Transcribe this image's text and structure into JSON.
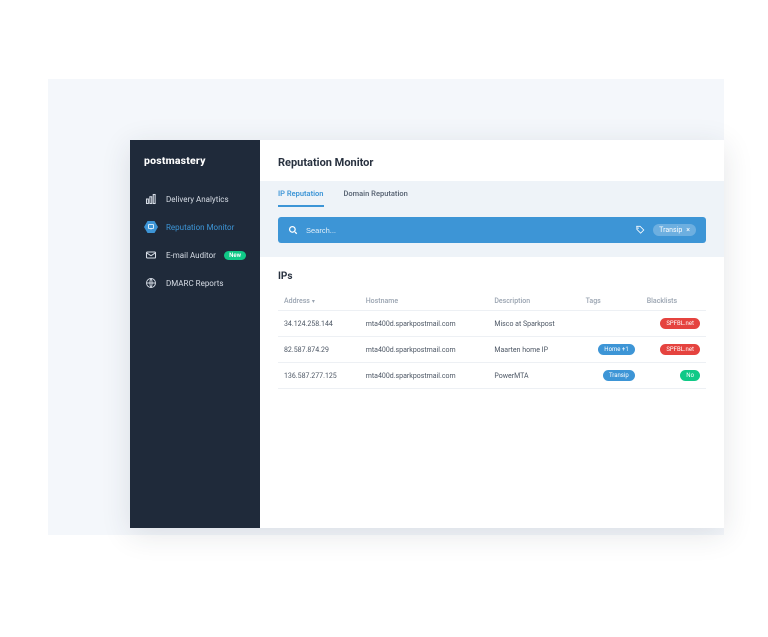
{
  "brand": "postmastery",
  "sidebar": {
    "items": [
      {
        "label": "Delivery Analytics"
      },
      {
        "label": "Reputation Monitor"
      },
      {
        "label": "E-mail Auditor",
        "badge": "New"
      },
      {
        "label": "DMARC Reports"
      }
    ]
  },
  "page": {
    "title": "Reputation Monitor",
    "tabs": [
      {
        "label": "IP Reputation",
        "active": true
      },
      {
        "label": "Domain Reputation",
        "active": false
      }
    ],
    "search": {
      "placeholder": "Search...",
      "active_filter": {
        "label": "Transip"
      }
    },
    "ips": {
      "heading": "IPs",
      "columns": {
        "address": "Address",
        "hostname": "Hostname",
        "description": "Description",
        "tags": "Tags",
        "blacklists": "Blacklists"
      },
      "rows": [
        {
          "address": "34.124.258.144",
          "hostname": "mta400d.sparkpostmail.com",
          "description": "Misco at Sparkpost",
          "tags": [],
          "blacklists": [
            {
              "label": "SPFBL.net",
              "color": "red"
            }
          ]
        },
        {
          "address": "82.587.874.29",
          "hostname": "mta400d.sparkpostmail.com",
          "description": "Maarten home IP",
          "tags": [
            {
              "label": "Home +1",
              "color": "blue"
            }
          ],
          "blacklists": [
            {
              "label": "SPFBL.net",
              "color": "red"
            }
          ]
        },
        {
          "address": "136.587.277.125",
          "hostname": "mta400d.sparkpostmail.com",
          "description": "PowerMTA",
          "tags": [
            {
              "label": "Transip",
              "color": "blue"
            }
          ],
          "blacklists": [
            {
              "label": "No",
              "color": "green"
            }
          ]
        }
      ]
    }
  },
  "close_x": "×"
}
